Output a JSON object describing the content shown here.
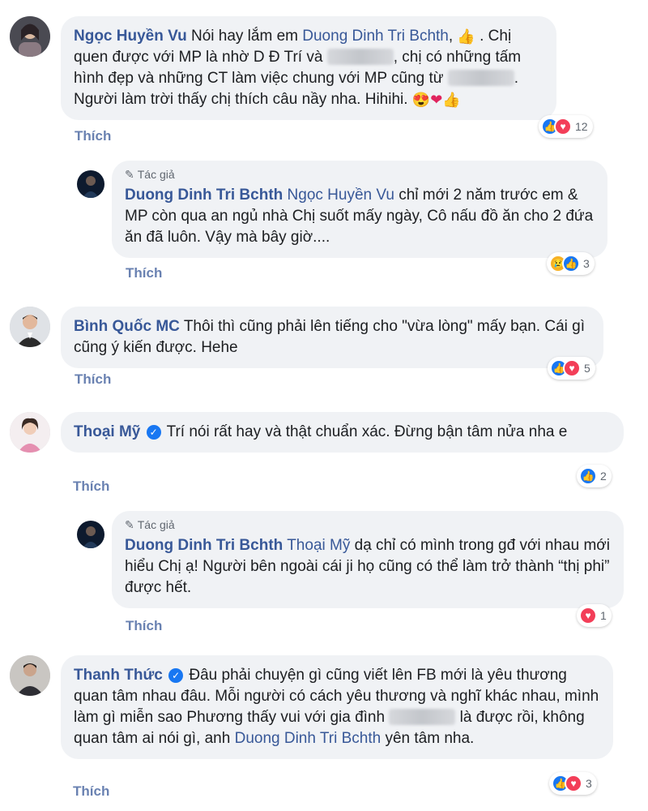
{
  "reaction_colors": {
    "like": "#1877f2",
    "love": "#f33e58",
    "sad": "#f7b125"
  },
  "author_badge": "Tác giả",
  "like_label": "Thích",
  "comments": [
    {
      "author": "Ngọc Huyền Vu",
      "mention": "Duong Dinh Tri Bchth",
      "text_1": "Nói hay lắm em",
      "text_2": ", ",
      "text_3": " . Chị quen được với MP là nhờ D Đ Trí và",
      "text_4": ", chị có những tấm hình đẹp và những CT làm việc chung với MP cũng từ",
      "text_5": ". Người làm trời thấy chị thích câu nầy nha. Hihihi.",
      "reaction_count": "12",
      "reactions": [
        "like-icon",
        "love-icon"
      ]
    },
    {
      "author": "Duong Dinh Tri Bchth",
      "mention": "Ngọc Huyền Vu",
      "text": "chỉ mới 2 năm trước em & MP còn qua an ngủ nhà Chị suốt mấy ngày, Cô nấu đồ ăn cho 2 đứa ăn đã luôn. Vậy mà bây giờ....",
      "reaction_count": "3",
      "reactions": [
        "sad-icon",
        "like-icon"
      ]
    },
    {
      "author": "Bình Quốc MC",
      "text": "Thôi thì cũng phải lên tiếng cho \"vừa lòng\" mấy bạn. Cái gì cũng ý kiến được. Hehe",
      "reaction_count": "5",
      "reactions": [
        "like-icon",
        "love-icon"
      ]
    },
    {
      "author": "Thoại Mỹ",
      "text": "Trí nói rất hay và thật chuẩn xác. Đừng bận tâm nửa nha e",
      "reaction_count": "2",
      "reactions": [
        "like-icon"
      ]
    },
    {
      "author": "Duong Dinh Tri Bchth",
      "mention": "Thoại Mỹ",
      "text": "dạ chỉ có mình trong gđ với nhau mới hiểu Chị ạ! Người bên ngoài cái ji họ cũng có thể làm trở thành “thị phi” được hết.",
      "reaction_count": "1",
      "reactions": [
        "love-icon"
      ]
    },
    {
      "author": "Thanh Thức",
      "text_1": "Đâu phải chuyện gì cũng viết lên FB mới là yêu thương quan tâm nhau đâu. Mỗi người có cách yêu thương và nghĩ khác nhau, mình làm gì miễn sao Phương thấy vui với gia đình",
      "text_2": " là được rồi, không quan tâm ai nói gì, anh",
      "mention": "Duong Dinh Tri Bchth",
      "text_3": " yên tâm nha.",
      "reaction_count": "3",
      "reactions": [
        "like-icon",
        "love-icon"
      ]
    }
  ]
}
